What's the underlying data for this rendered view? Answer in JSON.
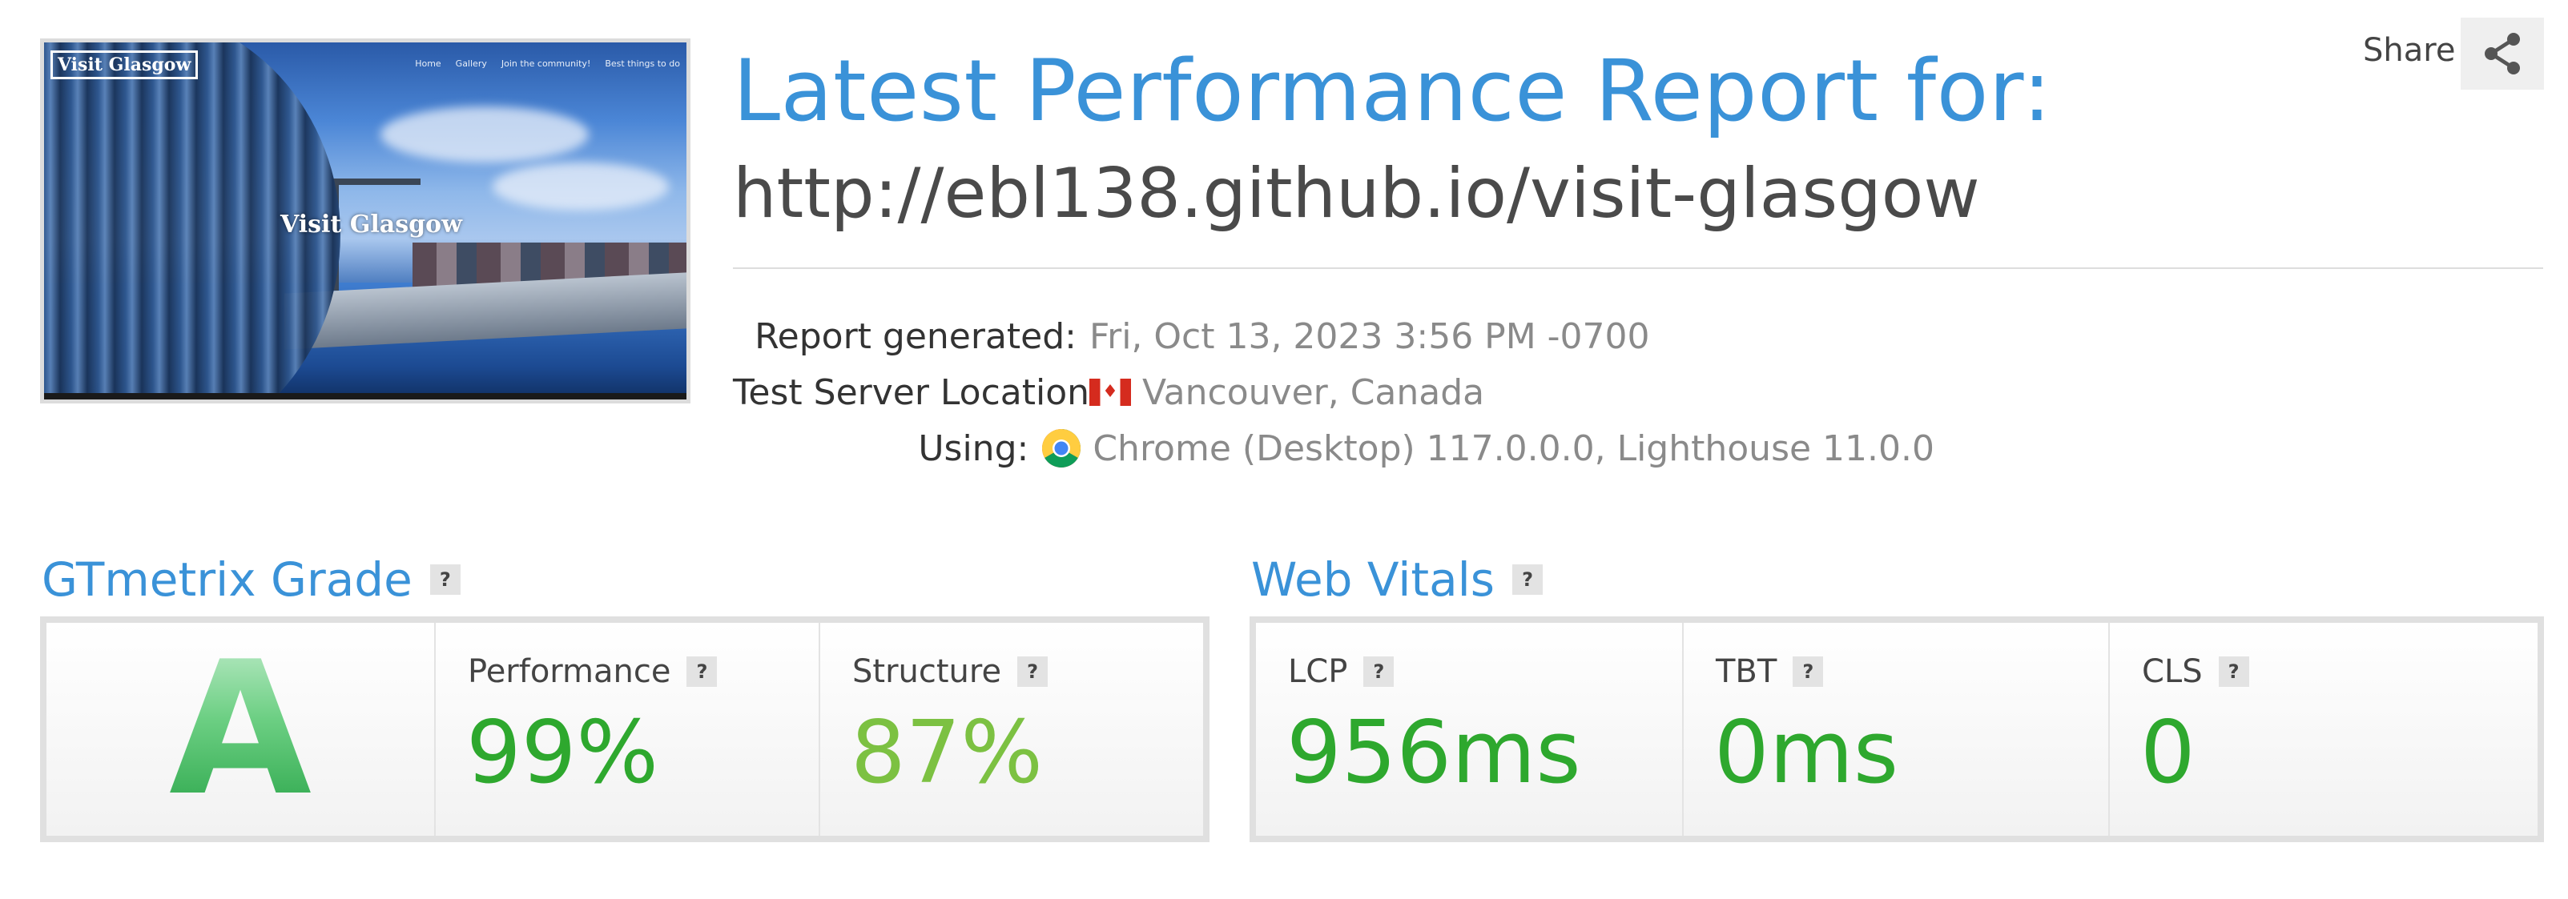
{
  "thumbnail": {
    "brand": "Visit Glasgow",
    "nav_links": [
      "Home",
      "Gallery",
      "Join the community!",
      "Best things to do"
    ],
    "hero_text": "Visit Glasgow"
  },
  "header": {
    "title": "Latest Performance Report for:",
    "url": "http://ebl138.github.io/visit-glasgow"
  },
  "share": {
    "label": "Share",
    "icon": "share-icon"
  },
  "meta": [
    {
      "label": "Report generated:",
      "value": "Fri, Oct 13, 2023 3:56 PM -0700",
      "icon": ""
    },
    {
      "label": "Test Server Location:",
      "value": "Vancouver, Canada",
      "icon": "canada-flag-icon"
    },
    {
      "label": "Using:",
      "value": "Chrome (Desktop) 117.0.0.0, Lighthouse 11.0.0",
      "icon": "chrome-icon"
    }
  ],
  "grade_section": {
    "title": "GTmetrix Grade",
    "help": "?",
    "grade": "A",
    "performance": {
      "label": "Performance",
      "help": "?",
      "value": "99%",
      "color": "#2ea82e"
    },
    "structure": {
      "label": "Structure",
      "help": "?",
      "value": "87%",
      "color": "#7cc142"
    }
  },
  "vitals_section": {
    "title": "Web Vitals",
    "help": "?",
    "items": [
      {
        "label": "LCP",
        "help": "?",
        "value": "956ms",
        "color": "#2ea82e"
      },
      {
        "label": "TBT",
        "help": "?",
        "value": "0ms",
        "color": "#2ea82e"
      },
      {
        "label": "CLS",
        "help": "?",
        "value": "0",
        "color": "#2ea82e"
      }
    ]
  }
}
